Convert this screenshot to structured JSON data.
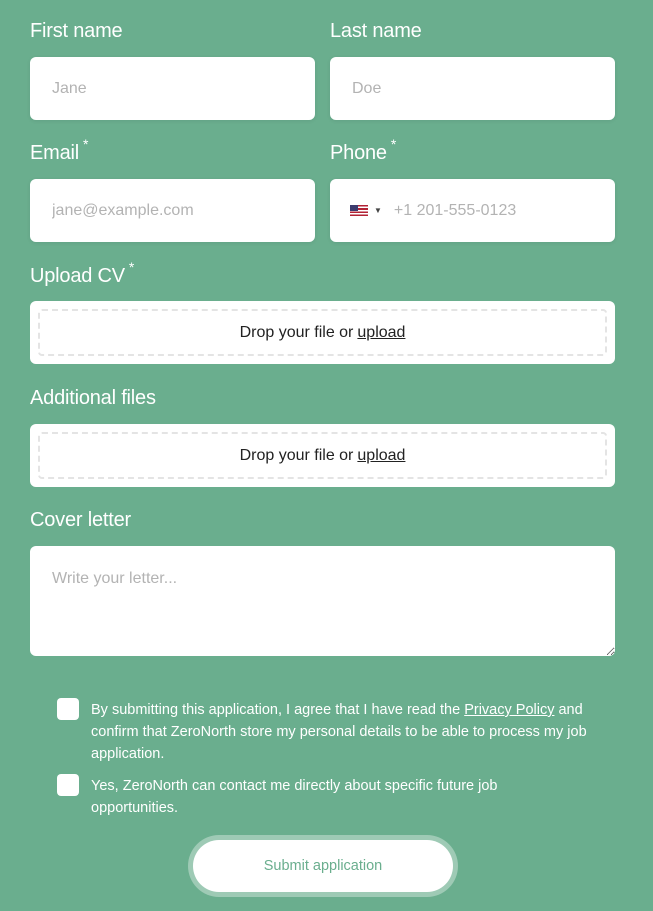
{
  "form": {
    "first_name": {
      "label": "First name",
      "placeholder": "Jane"
    },
    "last_name": {
      "label": "Last name",
      "placeholder": "Doe"
    },
    "email": {
      "label": "Email",
      "required_mark": "*",
      "placeholder": "jane@example.com"
    },
    "phone": {
      "label": "Phone",
      "required_mark": "*",
      "placeholder": "+1 201-555-0123",
      "country_flag": "us-flag-icon"
    },
    "upload_cv": {
      "label": "Upload CV",
      "required_mark": "*",
      "drop_text": "Drop your file or",
      "upload_link": "upload"
    },
    "additional_files": {
      "label": "Additional files",
      "drop_text": "Drop your file or",
      "upload_link": "upload"
    },
    "cover_letter": {
      "label": "Cover letter",
      "placeholder": "Write your letter..."
    }
  },
  "consent": {
    "privacy_prefix": "By submitting this application, I agree that I have read the",
    "privacy_link": "Privacy Policy",
    "privacy_suffix": "and confirm that ZeroNorth store my personal details to be able to process my job application.",
    "contact_text": "Yes, ZeroNorth can contact me directly about specific future job opportunities."
  },
  "submit": {
    "label": "Submit application"
  },
  "colors": {
    "background": "#6aae8e",
    "field": "#ffffff",
    "accent": "#6aae8e"
  }
}
